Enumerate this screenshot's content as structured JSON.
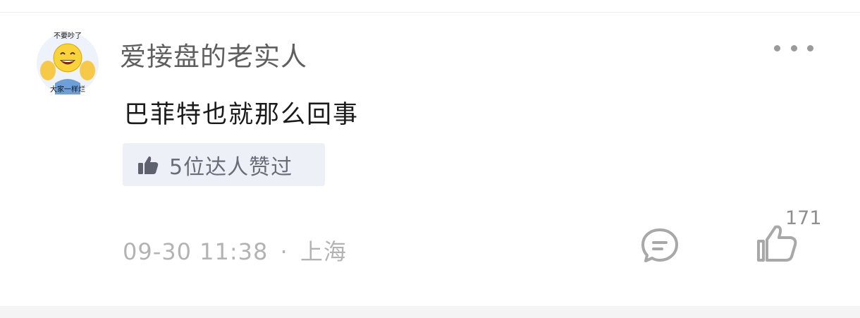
{
  "comment": {
    "avatar": {
      "caption_top": "不要吵了",
      "caption_bottom": "大家一样烂",
      "icon": "smiling-emoji-avatar-icon"
    },
    "username": "爱接盘的老实人",
    "more_icon": "more-dots-icon",
    "text": "巴菲特也就那么回事",
    "expert_badge": {
      "icon": "thumbs-up-icon",
      "label": "5位达人赞过"
    },
    "meta": {
      "timestamp": "09-30 11:38",
      "separator": "·",
      "location": "上海"
    },
    "reply_icon": "reply-bubble-icon",
    "like": {
      "icon": "like-thumb-icon",
      "count": "171"
    }
  },
  "colors": {
    "background": "#ffffff",
    "username": "#5f5f5f",
    "text": "#1a1a1a",
    "badge_bg": "#eef0f8",
    "meta": "#b3b3b3",
    "icon_gray": "#a8a8a8"
  }
}
